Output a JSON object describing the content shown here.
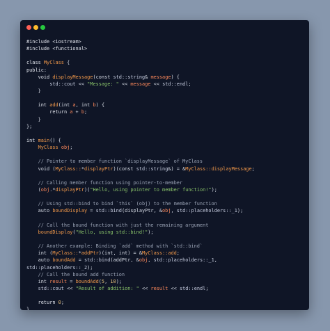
{
  "window": {
    "controls": [
      "close",
      "minimize",
      "maximize"
    ],
    "colors": {
      "background": "#0f1526",
      "page": "#8797ad",
      "close": "#ff5f56",
      "minimize": "#ffbd2e",
      "maximize": "#27c93f",
      "orange": "#f2994a",
      "green": "#8ac46a"
    }
  },
  "code_lines": [
    [
      [
        "include",
        "#include <iostream>"
      ]
    ],
    [
      [
        "include",
        "#include <functional>"
      ]
    ],
    [],
    [
      [
        "keyword",
        "class "
      ],
      [
        "class",
        "MyClass"
      ],
      [
        "default",
        " {"
      ]
    ],
    [
      [
        "keyword",
        "public:"
      ]
    ],
    [
      [
        "default",
        "    "
      ],
      [
        "keyword",
        "void "
      ],
      [
        "fn",
        "displayMessage"
      ],
      [
        "default",
        "(const "
      ],
      [
        "ns",
        "std::string"
      ],
      [
        "default",
        "& "
      ],
      [
        "param",
        "message"
      ],
      [
        "default",
        ") {"
      ]
    ],
    [
      [
        "default",
        "        "
      ],
      [
        "ns",
        "std::cout"
      ],
      [
        "default",
        " << "
      ],
      [
        "string",
        "\"Message: \""
      ],
      [
        "default",
        " << "
      ],
      [
        "param",
        "message"
      ],
      [
        "default",
        " << "
      ],
      [
        "ns",
        "std::endl"
      ],
      [
        "default",
        ";"
      ]
    ],
    [
      [
        "default",
        "    }"
      ]
    ],
    [],
    [
      [
        "default",
        "    "
      ],
      [
        "keyword",
        "int "
      ],
      [
        "fn",
        "add"
      ],
      [
        "default",
        "(int "
      ],
      [
        "param",
        "a"
      ],
      [
        "default",
        ", int "
      ],
      [
        "param",
        "b"
      ],
      [
        "default",
        ") {"
      ]
    ],
    [
      [
        "default",
        "        "
      ],
      [
        "keyword",
        "return "
      ],
      [
        "param",
        "a"
      ],
      [
        "default",
        " + "
      ],
      [
        "param",
        "b"
      ],
      [
        "default",
        ";"
      ]
    ],
    [
      [
        "default",
        "    }"
      ]
    ],
    [
      [
        "default",
        "};"
      ]
    ],
    [],
    [
      [
        "keyword",
        "int "
      ],
      [
        "fn",
        "main"
      ],
      [
        "default",
        "() {"
      ]
    ],
    [
      [
        "default",
        "    "
      ],
      [
        "class",
        "MyClass"
      ],
      [
        "default",
        " "
      ],
      [
        "param",
        "obj"
      ],
      [
        "default",
        ";"
      ]
    ],
    [],
    [
      [
        "comment",
        "    // Pointer to member function `displayMessage` of MyClass"
      ]
    ],
    [
      [
        "default",
        "    void ("
      ],
      [
        "class",
        "MyClass::"
      ],
      [
        "default",
        "*"
      ],
      [
        "fn",
        "displayPtr"
      ],
      [
        "default",
        ")(const "
      ],
      [
        "ns",
        "std::string"
      ],
      [
        "default",
        "&) = &"
      ],
      [
        "class",
        "MyClass::displayMessage"
      ],
      [
        "default",
        ";"
      ]
    ],
    [],
    [
      [
        "comment",
        "    // Calling member function using pointer-to-member"
      ]
    ],
    [
      [
        "default",
        "    ("
      ],
      [
        "param",
        "obj"
      ],
      [
        "default",
        ".*"
      ],
      [
        "fn",
        "displayPtr"
      ],
      [
        "default",
        ")("
      ],
      [
        "string",
        "\"Hello, using pointer to member function!\""
      ],
      [
        "default",
        ");"
      ]
    ],
    [],
    [
      [
        "comment",
        "    // Using std::bind to bind `this` (obj) to the member function"
      ]
    ],
    [
      [
        "default",
        "    auto "
      ],
      [
        "fn",
        "boundDisplay"
      ],
      [
        "default",
        " = "
      ],
      [
        "ns",
        "std::bind"
      ],
      [
        "default",
        "(displayPtr, &"
      ],
      [
        "param",
        "obj"
      ],
      [
        "default",
        ", "
      ],
      [
        "ns",
        "std::placeholders::_1"
      ],
      [
        "default",
        ");"
      ]
    ],
    [],
    [
      [
        "comment",
        "    // Call the bound function with just the remaining argument"
      ]
    ],
    [
      [
        "default",
        "    "
      ],
      [
        "fn",
        "boundDisplay"
      ],
      [
        "default",
        "("
      ],
      [
        "string",
        "\"Hello, using std::bind!\""
      ],
      [
        "default",
        ");"
      ]
    ],
    [],
    [
      [
        "comment",
        "    // Another example: Binding `add` method with `std::bind`"
      ]
    ],
    [
      [
        "default",
        "    int ("
      ],
      [
        "class",
        "MyClass::"
      ],
      [
        "default",
        "*"
      ],
      [
        "fn",
        "addPtr"
      ],
      [
        "default",
        ")(int, int) = &"
      ],
      [
        "class",
        "MyClass::add"
      ],
      [
        "default",
        ";"
      ]
    ],
    [
      [
        "default",
        "    auto "
      ],
      [
        "fn",
        "boundAdd"
      ],
      [
        "default",
        " = "
      ],
      [
        "ns",
        "std::bind"
      ],
      [
        "default",
        "(addPtr, &"
      ],
      [
        "param",
        "obj"
      ],
      [
        "default",
        ", "
      ],
      [
        "ns",
        "std::placeholders::_1"
      ],
      [
        "default",
        ","
      ]
    ],
    [
      [
        "ns",
        "std::placeholders::_2"
      ],
      [
        "default",
        ");"
      ]
    ],
    [
      [
        "comment",
        "    // Call the bound add function"
      ]
    ],
    [
      [
        "default",
        "    int "
      ],
      [
        "param",
        "result"
      ],
      [
        "default",
        " = "
      ],
      [
        "fn",
        "boundAdd"
      ],
      [
        "default",
        "("
      ],
      [
        "number",
        "5"
      ],
      [
        "default",
        ", "
      ],
      [
        "number",
        "10"
      ],
      [
        "default",
        ");"
      ]
    ],
    [
      [
        "default",
        "    "
      ],
      [
        "ns",
        "std::cout"
      ],
      [
        "default",
        " << "
      ],
      [
        "string",
        "\"Result of addition: \""
      ],
      [
        "default",
        " << "
      ],
      [
        "param",
        "result"
      ],
      [
        "default",
        " << "
      ],
      [
        "ns",
        "std::endl"
      ],
      [
        "default",
        ";"
      ]
    ],
    [],
    [
      [
        "default",
        "    "
      ],
      [
        "keyword",
        "return "
      ],
      [
        "number",
        "0"
      ],
      [
        "default",
        ";"
      ]
    ],
    [
      [
        "default",
        "}"
      ]
    ]
  ]
}
